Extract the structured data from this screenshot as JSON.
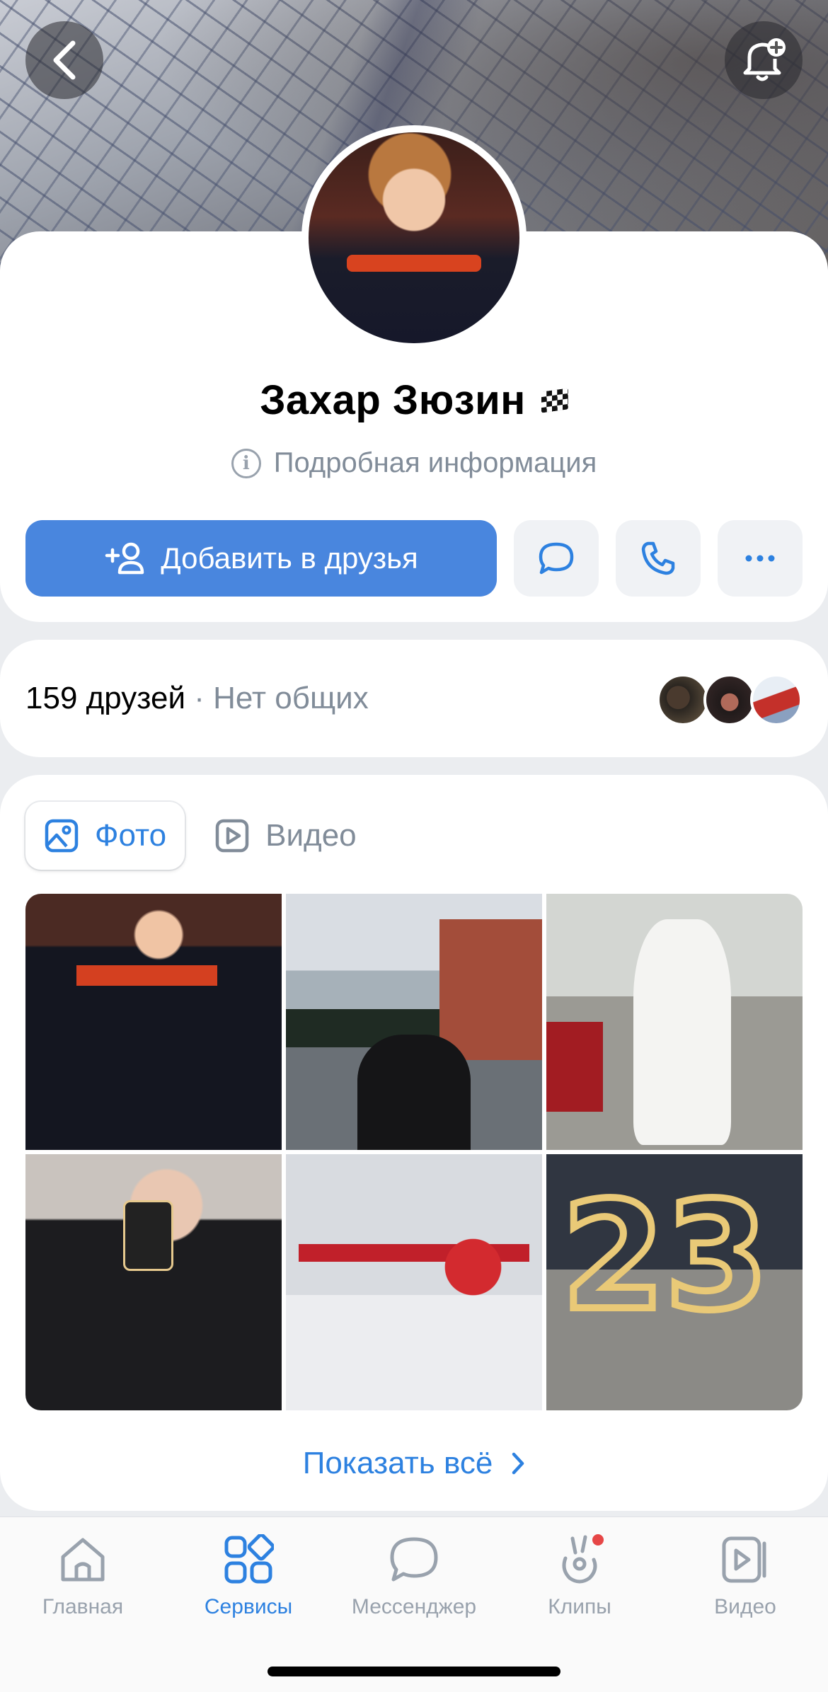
{
  "header": {
    "back_icon": "chevron-left-icon",
    "notify_icon": "bell-plus-icon"
  },
  "profile": {
    "name": "Захар Зюзин",
    "status_icon": "checkered-flag-icon",
    "info_label": "Подробная информация",
    "add_friend_label": "Добавить в друзья",
    "message_icon": "chat-bubble-icon",
    "call_icon": "phone-icon",
    "more_icon": "more-dots-icon"
  },
  "friends": {
    "count": "159 друзей",
    "mutual": " · Нет общих"
  },
  "media": {
    "tabs": [
      {
        "label": "Фото",
        "icon": "photo-icon",
        "active": true
      },
      {
        "label": "Видео",
        "icon": "video-icon",
        "active": false
      }
    ],
    "show_all": "Показать всё"
  },
  "nav": {
    "items": [
      {
        "label": "Главная",
        "icon": "home-icon"
      },
      {
        "label": "Сервисы",
        "icon": "services-icon",
        "active": true
      },
      {
        "label": "Мессенджер",
        "icon": "messenger-icon"
      },
      {
        "label": "Клипы",
        "icon": "clips-icon",
        "badge": true
      },
      {
        "label": "Видео",
        "icon": "video-play-icon"
      }
    ]
  },
  "colors": {
    "accent": "#2d81e0",
    "button": "#4986de",
    "secondary_text": "#818c99",
    "badge": "#e64646"
  }
}
